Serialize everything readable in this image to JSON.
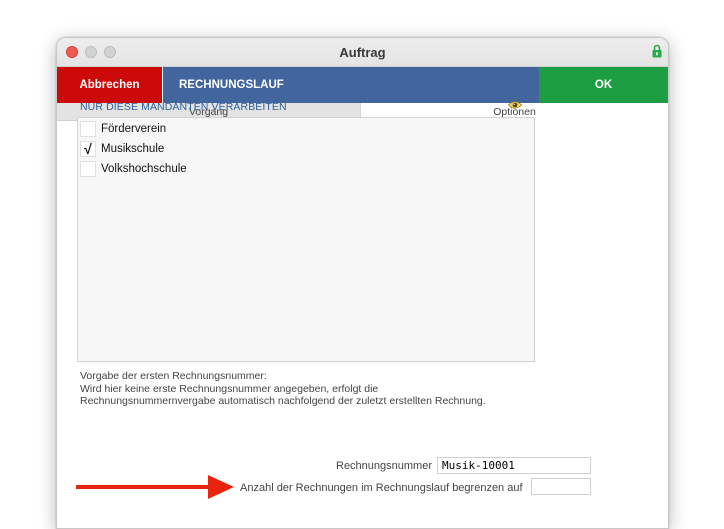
{
  "window": {
    "title": "Auftrag"
  },
  "actionbar": {
    "cancel_label": "Abbrechen",
    "title": "RECHNUNGSLAUF",
    "ok_label": "OK"
  },
  "tabs": [
    {
      "label": "Vorgang"
    },
    {
      "label": "Optionen"
    }
  ],
  "mandanten": {
    "heading": "NUR DIESE MANDANTEN VERARBEITEN",
    "items": [
      {
        "label": "Förderverein",
        "checked": false
      },
      {
        "label": "Musikschule",
        "checked": true
      },
      {
        "label": "Volkshochschule",
        "checked": false
      }
    ]
  },
  "note": {
    "line1": "Vorgabe der ersten Rechnungsnummer:",
    "line2": "Wird hier keine erste Rechnungsnummer angegeben, erfolgt die",
    "line3": "Rechnungsnummernvergabe automatisch nachfolgend der zuletzt erstellten Rechnung."
  },
  "fields": {
    "rechnungsnummer_label": "Rechnungsnummer",
    "rechnungsnummer_value": "Musik-10001",
    "limit_label": "Anzahl der Rechnungen im Rechnungslauf begrenzen auf",
    "limit_value": ""
  },
  "checkmark_glyph": "√",
  "colors": {
    "cancel": "#cc0a0a",
    "title_bar": "#41659c",
    "ok": "#1e9e43",
    "heading": "#2c5f9c",
    "arrow": "#e8230f"
  }
}
